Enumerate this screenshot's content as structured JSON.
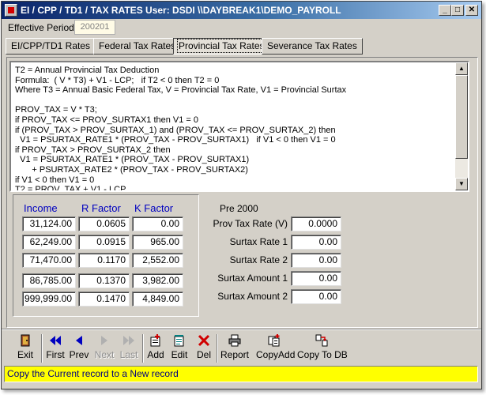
{
  "window": {
    "title": "EI / CPP / TD1 / TAX RATES  User: DSDI  \\\\DAYBREAK1\\DEMO_PAYROLL",
    "minimize_icon": "minimize-icon",
    "maximize_icon": "maximize-icon",
    "close_icon": "close-icon"
  },
  "effective_period": {
    "label": "Effective Period",
    "value": "200201"
  },
  "tabs": [
    {
      "label": "EI/CPP/TD1 Rates",
      "active": false
    },
    {
      "label": "Federal Tax Rates",
      "active": false
    },
    {
      "label": "Provincial Tax Rates",
      "active": true
    },
    {
      "label": "Severance Tax Rates",
      "active": false
    }
  ],
  "formula": {
    "lines": [
      "T2 = Annual Provincial Tax Deduction",
      "Formula:  ( V * T3) + V1 - LCP;   if T2 < 0 then T2 = 0",
      "Where T3 = Annual Basic Federal Tax, V = Provincial Tax Rate, V1 = Provincial Surtax",
      "",
      "PROV_TAX = V * T3;",
      "if PROV_TAX <= PROV_SURTAX1 then V1 = 0",
      "if (PROV_TAX > PROV_SURTAX_1) and (PROV_TAX <= PROV_SURTAX_2) then",
      "  V1 = PSURTAX_RATE1 * (PROV_TAX - PROV_SURTAX1)   if V1 < 0 then V1 = 0",
      "if PROV_TAX > PROV_SURTAX_2 then",
      "  V1 = PSURTAX_RATE1 * (PROV_TAX - PROV_SURTAX1)",
      "       + PSURTAX_RATE2 * (PROV_TAX - PROV_SURTAX2)",
      "if V1 < 0 then V1 = 0",
      "T2 = PROV_TAX + V1 - LCP"
    ]
  },
  "brackets": {
    "headers": {
      "income": "Income",
      "r_factor": "R Factor",
      "k_factor": "K Factor"
    },
    "rows": [
      {
        "income": "31,124.00",
        "r": "0.0605",
        "k": "0.00"
      },
      {
        "income": "62,249.00",
        "r": "0.0915",
        "k": "965.00"
      },
      {
        "income": "71,470.00",
        "r": "0.1170",
        "k": "2,552.00"
      },
      {
        "income": "86,785.00",
        "r": "0.1370",
        "k": "3,982.00"
      },
      {
        "income": "999,999.00",
        "r": "0.1470",
        "k": "4,849.00"
      }
    ]
  },
  "pre2000": {
    "heading": "Pre 2000",
    "fields": [
      {
        "label": "Prov Tax Rate (V)",
        "value": "0.0000"
      },
      {
        "label": "Surtax Rate 1",
        "value": "0.00"
      },
      {
        "label": "Surtax Rate 2",
        "value": "0.00"
      },
      {
        "label": "Surtax Amount 1",
        "value": "0.00"
      },
      {
        "label": "Surtax Amount 2",
        "value": "0.00"
      }
    ]
  },
  "toolbar": {
    "exit": {
      "label": "Exit",
      "icon": "exit-door-icon"
    },
    "first": {
      "label": "First",
      "icon": "first-record-icon"
    },
    "prev": {
      "label": "Prev",
      "icon": "previous-record-icon"
    },
    "next": {
      "label": "Next",
      "icon": "next-record-icon"
    },
    "last": {
      "label": "Last",
      "icon": "last-record-icon"
    },
    "add": {
      "label": "Add",
      "icon": "add-record-icon"
    },
    "edit": {
      "label": "Edit",
      "icon": "edit-record-icon"
    },
    "del": {
      "label": "Del",
      "icon": "delete-x-icon"
    },
    "report": {
      "label": "Report",
      "icon": "printer-icon"
    },
    "copyadd": {
      "label": "CopyAdd",
      "icon": "copy-add-icon"
    },
    "copytodb": {
      "label": "Copy To DB",
      "icon": "copy-to-db-icon"
    }
  },
  "status": {
    "message": "Copy the Current record to a New record",
    "color": "#ffff00"
  }
}
